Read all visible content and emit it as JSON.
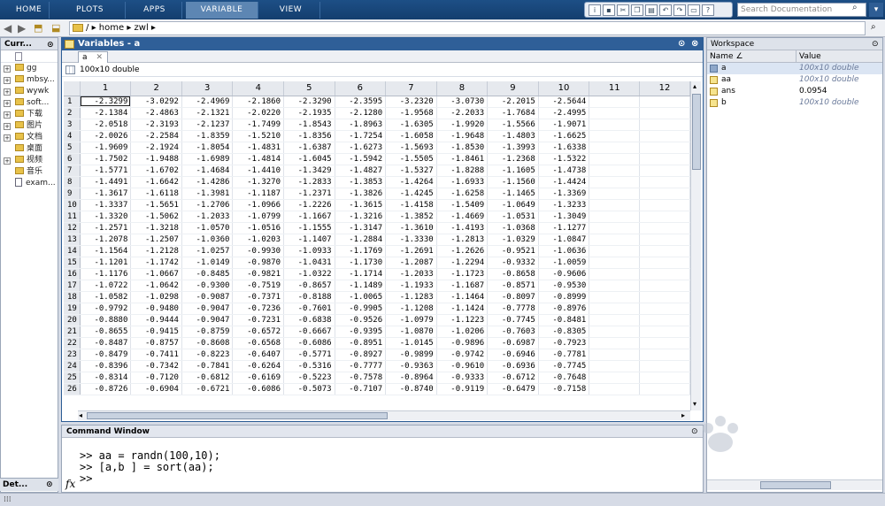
{
  "tabs": [
    "HOME",
    "PLOTS",
    "APPS",
    "VARIABLE",
    "VIEW"
  ],
  "search": {
    "placeholder": "Search Documentation"
  },
  "path": [
    "/",
    "home",
    "zwl"
  ],
  "left": {
    "title": "Curr...",
    "items": [
      {
        "name": "gg",
        "kind": "folder",
        "expand": true
      },
      {
        "name": "mbsy...",
        "kind": "folder",
        "expand": true
      },
      {
        "name": "wywk",
        "kind": "folder",
        "expand": true
      },
      {
        "name": "soft...",
        "kind": "folder",
        "expand": true
      },
      {
        "name": "下载",
        "kind": "folder",
        "expand": true
      },
      {
        "name": "图片",
        "kind": "folder",
        "expand": true
      },
      {
        "name": "文档",
        "kind": "folder",
        "expand": true
      },
      {
        "name": "桌面",
        "kind": "folder",
        "expand": false
      },
      {
        "name": "视频",
        "kind": "folder",
        "expand": true
      },
      {
        "name": "音乐",
        "kind": "folder",
        "expand": false
      },
      {
        "name": "exam...",
        "kind": "file",
        "expand": false
      }
    ],
    "details": "Det..."
  },
  "variables": {
    "title": "Variables - a",
    "tab": "a",
    "info": "100x10 double",
    "columns": [
      "1",
      "2",
      "3",
      "4",
      "5",
      "6",
      "7",
      "8",
      "9",
      "10",
      "11",
      "12"
    ],
    "rows": [
      [
        "-2.3299",
        "-3.0292",
        "-2.4969",
        "-2.1860",
        "-2.3290",
        "-2.3595",
        "-3.2320",
        "-3.0730",
        "-2.2015",
        "-2.5644"
      ],
      [
        "-2.1384",
        "-2.4863",
        "-2.1321",
        "-2.0220",
        "-2.1935",
        "-2.1280",
        "-1.9568",
        "-2.2033",
        "-1.7684",
        "-2.4995"
      ],
      [
        "-2.0518",
        "-2.3193",
        "-2.1237",
        "-1.7499",
        "-1.8543",
        "-1.8963",
        "-1.6305",
        "-1.9920",
        "-1.5566",
        "-1.9071"
      ],
      [
        "-2.0026",
        "-2.2584",
        "-1.8359",
        "-1.5210",
        "-1.8356",
        "-1.7254",
        "-1.6058",
        "-1.9648",
        "-1.4803",
        "-1.6625"
      ],
      [
        "-1.9609",
        "-2.1924",
        "-1.8054",
        "-1.4831",
        "-1.6387",
        "-1.6273",
        "-1.5693",
        "-1.8530",
        "-1.3993",
        "-1.6338"
      ],
      [
        "-1.7502",
        "-1.9488",
        "-1.6989",
        "-1.4814",
        "-1.6045",
        "-1.5942",
        "-1.5505",
        "-1.8461",
        "-1.2368",
        "-1.5322"
      ],
      [
        "-1.5771",
        "-1.6702",
        "-1.4684",
        "-1.4410",
        "-1.3429",
        "-1.4827",
        "-1.5327",
        "-1.8288",
        "-1.1605",
        "-1.4738"
      ],
      [
        "-1.4491",
        "-1.6642",
        "-1.4286",
        "-1.3270",
        "-1.2833",
        "-1.3853",
        "-1.4264",
        "-1.6933",
        "-1.1560",
        "-1.4424"
      ],
      [
        "-1.3617",
        "-1.6118",
        "-1.3981",
        "-1.1187",
        "-1.2371",
        "-1.3826",
        "-1.4245",
        "-1.6258",
        "-1.1465",
        "-1.3369"
      ],
      [
        "-1.3337",
        "-1.5651",
        "-1.2706",
        "-1.0966",
        "-1.2226",
        "-1.3615",
        "-1.4158",
        "-1.5409",
        "-1.0649",
        "-1.3233"
      ],
      [
        "-1.3320",
        "-1.5062",
        "-1.2033",
        "-1.0799",
        "-1.1667",
        "-1.3216",
        "-1.3852",
        "-1.4669",
        "-1.0531",
        "-1.3049"
      ],
      [
        "-1.2571",
        "-1.3218",
        "-1.0570",
        "-1.0516",
        "-1.1555",
        "-1.3147",
        "-1.3610",
        "-1.4193",
        "-1.0368",
        "-1.1277"
      ],
      [
        "-1.2078",
        "-1.2507",
        "-1.0360",
        "-1.0203",
        "-1.1407",
        "-1.2884",
        "-1.3330",
        "-1.2813",
        "-1.0329",
        "-1.0847"
      ],
      [
        "-1.1564",
        "-1.2128",
        "-1.0257",
        "-0.9930",
        "-1.0933",
        "-1.1769",
        "-1.2691",
        "-1.2626",
        "-0.9521",
        "-1.0636"
      ],
      [
        "-1.1201",
        "-1.1742",
        "-1.0149",
        "-0.9870",
        "-1.0431",
        "-1.1730",
        "-1.2087",
        "-1.2294",
        "-0.9332",
        "-1.0059"
      ],
      [
        "-1.1176",
        "-1.0667",
        "-0.8485",
        "-0.9821",
        "-1.0322",
        "-1.1714",
        "-1.2033",
        "-1.1723",
        "-0.8658",
        "-0.9606"
      ],
      [
        "-1.0722",
        "-1.0642",
        "-0.9300",
        "-0.7519",
        "-0.8657",
        "-1.1489",
        "-1.1933",
        "-1.1687",
        "-0.8571",
        "-0.9530"
      ],
      [
        "-1.0582",
        "-1.0298",
        "-0.9087",
        "-0.7371",
        "-0.8188",
        "-1.0065",
        "-1.1283",
        "-1.1464",
        "-0.8097",
        "-0.8999"
      ],
      [
        "-0.9792",
        "-0.9480",
        "-0.9047",
        "-0.7236",
        "-0.7601",
        "-0.9905",
        "-1.1208",
        "-1.1424",
        "-0.7778",
        "-0.8976"
      ],
      [
        "-0.8880",
        "-0.9444",
        "-0.9047",
        "-0.7231",
        "-0.6838",
        "-0.9526",
        "-1.0979",
        "-1.1223",
        "-0.7745",
        "-0.8481"
      ],
      [
        "-0.8655",
        "-0.9415",
        "-0.8759",
        "-0.6572",
        "-0.6667",
        "-0.9395",
        "-1.0870",
        "-1.0206",
        "-0.7603",
        "-0.8305"
      ],
      [
        "-0.8487",
        "-0.8757",
        "-0.8608",
        "-0.6568",
        "-0.6086",
        "-0.8951",
        "-1.0145",
        "-0.9896",
        "-0.6987",
        "-0.7923"
      ],
      [
        "-0.8479",
        "-0.7411",
        "-0.8223",
        "-0.6407",
        "-0.5771",
        "-0.8927",
        "-0.9899",
        "-0.9742",
        "-0.6946",
        "-0.7781"
      ],
      [
        "-0.8396",
        "-0.7342",
        "-0.7841",
        "-0.6264",
        "-0.5316",
        "-0.7777",
        "-0.9363",
        "-0.9610",
        "-0.6936",
        "-0.7745"
      ],
      [
        "-0.8314",
        "-0.7120",
        "-0.6812",
        "-0.6169",
        "-0.5223",
        "-0.7578",
        "-0.8964",
        "-0.9333",
        "-0.6712",
        "-0.7648"
      ],
      [
        "-0.8726",
        "-0.6904",
        "-0.6721",
        "-0.6086",
        "-0.5073",
        "-0.7107",
        "-0.8740",
        "-0.9119",
        "-0.6479",
        "-0.7158"
      ]
    ]
  },
  "command": {
    "title": "Command Window",
    "lines": [
      ">> aa = randn(100,10);",
      ">> [a,b ] = sort(aa);",
      ">>"
    ],
    "fx": "fx"
  },
  "workspace": {
    "title": "Workspace",
    "col_name": "Name",
    "col_value": "Value",
    "vars": [
      {
        "name": "a",
        "value": "100x10 double",
        "italic": true
      },
      {
        "name": "aa",
        "value": "100x10 double",
        "italic": true
      },
      {
        "name": "ans",
        "value": "0.0954",
        "italic": false
      },
      {
        "name": "b",
        "value": "100x10 double",
        "italic": true
      }
    ]
  }
}
